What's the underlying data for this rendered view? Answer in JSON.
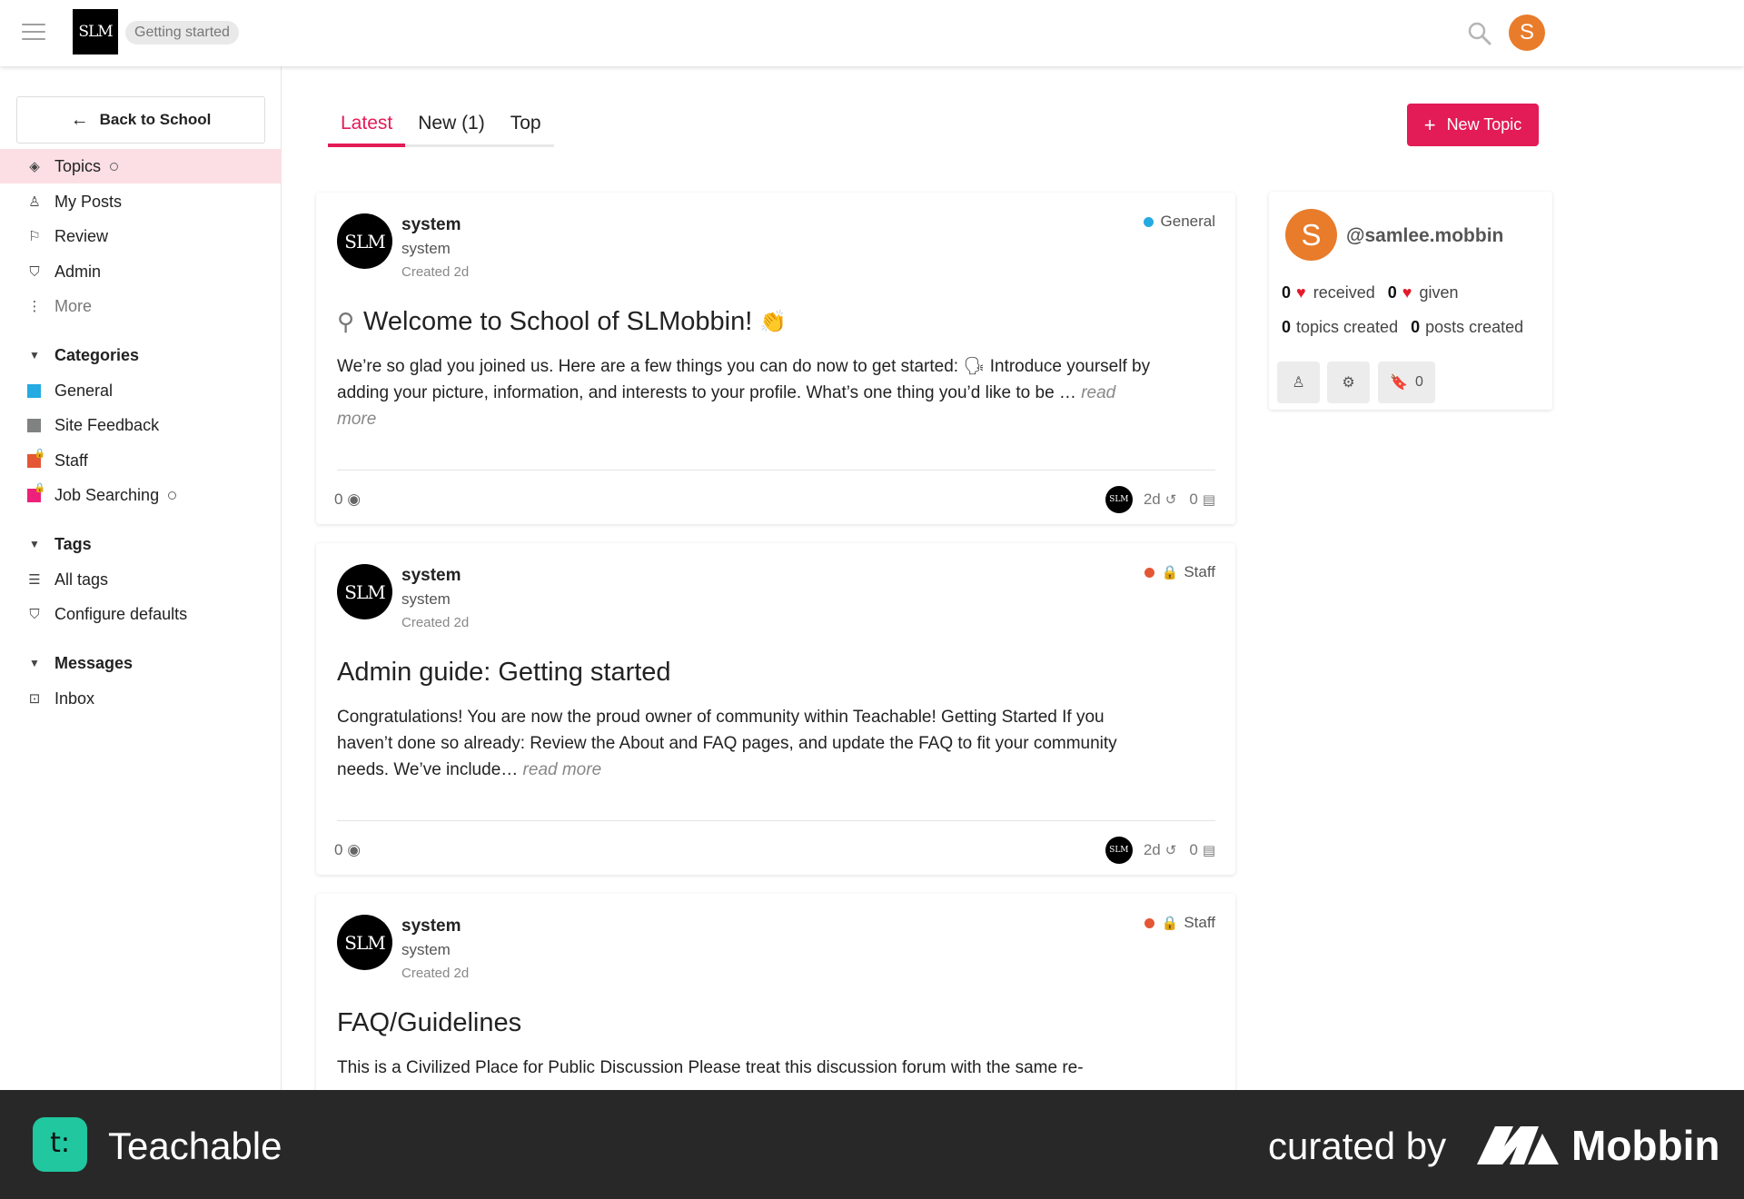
{
  "header": {
    "logo_text": "SLM",
    "breadcrumb": "Getting started",
    "user_initial": "S"
  },
  "sidebar": {
    "back_label": "Back to School",
    "nav": [
      {
        "label": "Topics",
        "icon": "layers-icon",
        "active": true
      },
      {
        "label": "My Posts",
        "icon": "user-icon"
      },
      {
        "label": "Review",
        "icon": "flag-icon"
      },
      {
        "label": "Admin",
        "icon": "shield-icon"
      },
      {
        "label": "More",
        "icon": "vertical-dots-icon"
      }
    ],
    "categories_title": "Categories",
    "categories": [
      {
        "label": "General",
        "color": "#25aae1"
      },
      {
        "label": "Site Feedback",
        "color": "#808281"
      },
      {
        "label": "Staff",
        "color": "#e45735"
      },
      {
        "label": "Job Searching",
        "color": "#ed207b"
      }
    ],
    "tags_title": "Tags",
    "tags": [
      {
        "label": "All tags",
        "icon": "list-icon"
      },
      {
        "label": "Configure defaults",
        "icon": "shield-icon"
      }
    ],
    "messages_title": "Messages",
    "messages": [
      {
        "label": "Inbox",
        "icon": "inbox-icon"
      }
    ]
  },
  "tabs": [
    "Latest",
    "New (1)",
    "Top"
  ],
  "new_topic_label": "New Topic",
  "topics": [
    {
      "author": "system",
      "username": "system",
      "created": "Created 2d",
      "category": "General",
      "category_color": "#25aae1",
      "title": "Welcome to School of SLMobbin!",
      "excerpt": "We’re so glad you joined us. Here are a few things you can do now to get started: 🗣 Introduce yourself by adding your picture, information, and interests to your profile. What’s one thing you’d like to be …",
      "read_more": "read more",
      "views": "0",
      "age": "2d",
      "replies": "0"
    },
    {
      "author": "system",
      "username": "system",
      "created": "Created 2d",
      "category": "Staff",
      "category_color": "#e45735",
      "title": "Admin guide: Getting started",
      "excerpt": "Congratulations! You are now the proud owner of community within Teachable! Getting Started If you haven’t done so already: Review the About and FAQ pages, and update the FAQ to fit your community needs. We’ve include…",
      "read_more": "read more",
      "views": "0",
      "age": "2d",
      "replies": "0"
    },
    {
      "author": "system",
      "username": "system",
      "created": "Created 2d",
      "category": "Staff",
      "category_color": "#e45735",
      "title": "FAQ/Guidelines",
      "excerpt": "This is a Civilized Place for Public Discussion Please treat this discussion forum with the same re-"
    }
  ],
  "user_card": {
    "initial": "S",
    "handle": "@samlee.mobbin",
    "received_count": "0",
    "received_label": "received",
    "given_count": "0",
    "given_label": "given",
    "topics_count": "0",
    "topics_label": "topics created",
    "posts_count": "0",
    "posts_label": "posts created",
    "bookmarks": "0"
  },
  "footer": {
    "app_name": "Teachable",
    "curated_by": "curated by",
    "brand": "Mobbin"
  }
}
